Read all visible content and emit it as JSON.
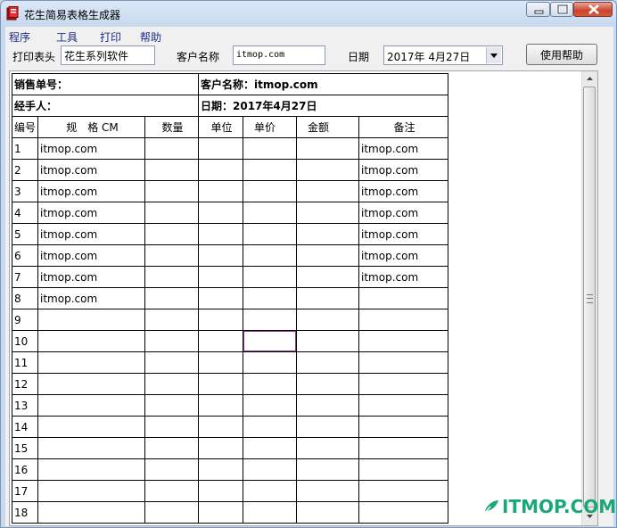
{
  "window": {
    "title": "花生简易表格生成器"
  },
  "menu": [
    "程序",
    "工具",
    "打印",
    "帮助"
  ],
  "toolbar": {
    "header_label": "打印表头",
    "header_value": "花生系列软件",
    "customer_label": "客户名称",
    "customer_value": "itmop.com",
    "date_label": "日期",
    "date_value": "2017年  4月27日",
    "help_button": "使用帮助"
  },
  "sheet": {
    "sales_no_label": "销售单号：",
    "customer_line": "客户名称：itmop.com",
    "handler_label": "经手人：",
    "date_line": "日期：2017年4月27日",
    "columns": [
      "编号",
      "规　格 CM",
      "数量",
      "单位",
      "单价",
      "金额",
      "备注"
    ],
    "rows": [
      {
        "no": "1",
        "spec": "itmop.com",
        "note": "itmop.com"
      },
      {
        "no": "2",
        "spec": "itmop.com",
        "note": "itmop.com"
      },
      {
        "no": "3",
        "spec": "itmop.com",
        "note": "itmop.com"
      },
      {
        "no": "4",
        "spec": "itmop.com",
        "note": "itmop.com"
      },
      {
        "no": "5",
        "spec": "itmop.com",
        "note": "itmop.com"
      },
      {
        "no": "6",
        "spec": "itmop.com",
        "note": "itmop.com"
      },
      {
        "no": "7",
        "spec": "itmop.com",
        "note": "itmop.com"
      },
      {
        "no": "8",
        "spec": "itmop.com",
        "note": ""
      },
      {
        "no": "9",
        "spec": "",
        "note": ""
      },
      {
        "no": "10",
        "spec": "",
        "note": ""
      },
      {
        "no": "11",
        "spec": "",
        "note": ""
      },
      {
        "no": "12",
        "spec": "",
        "note": ""
      },
      {
        "no": "13",
        "spec": "",
        "note": ""
      },
      {
        "no": "14",
        "spec": "",
        "note": ""
      },
      {
        "no": "15",
        "spec": "",
        "note": ""
      },
      {
        "no": "16",
        "spec": "",
        "note": ""
      },
      {
        "no": "17",
        "spec": "",
        "note": ""
      },
      {
        "no": "18",
        "spec": "",
        "note": ""
      }
    ],
    "selected_row": "10",
    "selected_column": "单价"
  },
  "watermark": {
    "text": "ITMOP.COM",
    "color": "#1aa87a"
  },
  "icons": [
    "app-icon",
    "minimize-icon",
    "maximize-icon",
    "close-icon",
    "dropdown-arrow-icon",
    "scroll-up-icon",
    "scroll-down-icon"
  ]
}
